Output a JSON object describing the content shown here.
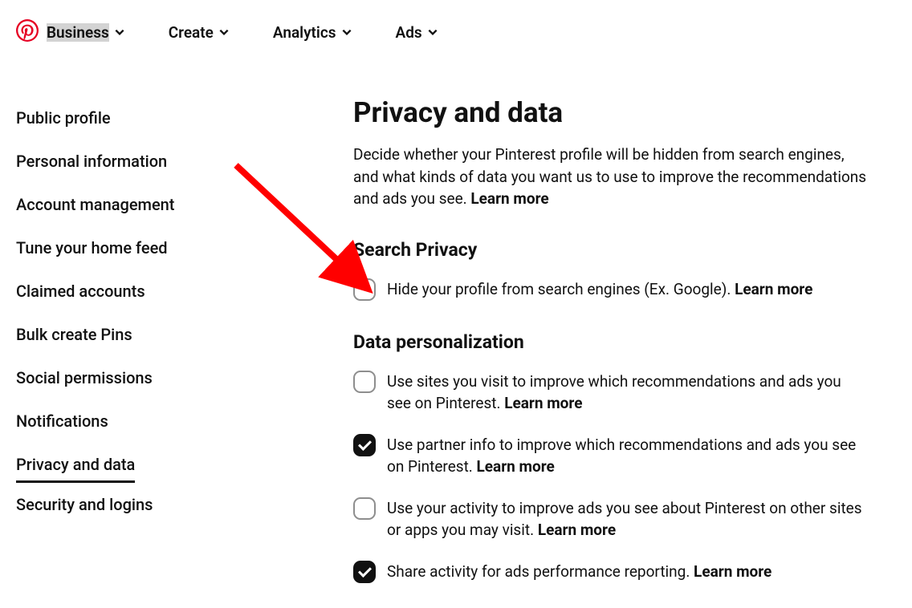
{
  "topnav": {
    "items": [
      {
        "label": "Business",
        "highlighted": true
      },
      {
        "label": "Create",
        "highlighted": false
      },
      {
        "label": "Analytics",
        "highlighted": false
      },
      {
        "label": "Ads",
        "highlighted": false
      }
    ]
  },
  "sidebar": {
    "items": [
      {
        "label": "Public profile",
        "active": false
      },
      {
        "label": "Personal information",
        "active": false
      },
      {
        "label": "Account management",
        "active": false
      },
      {
        "label": "Tune your home feed",
        "active": false
      },
      {
        "label": "Claimed accounts",
        "active": false
      },
      {
        "label": "Bulk create Pins",
        "active": false
      },
      {
        "label": "Social permissions",
        "active": false
      },
      {
        "label": "Notifications",
        "active": false
      },
      {
        "label": "Privacy and data",
        "active": true
      },
      {
        "label": "Security and logins",
        "active": false
      }
    ]
  },
  "content": {
    "title": "Privacy and data",
    "description": "Decide whether your Pinterest profile will be hidden from search engines, and what kinds of data you want us to use to improve the recommendations and ads you see. ",
    "learnMore": "Learn more",
    "sections": [
      {
        "title": "Search Privacy",
        "options": [
          {
            "text": "Hide your profile from search engines (Ex. Google). ",
            "learnMore": "Learn more",
            "checked": false
          }
        ]
      },
      {
        "title": "Data personalization",
        "options": [
          {
            "text": "Use sites you visit to improve which recommendations and ads you see on Pinterest. ",
            "learnMore": "Learn more",
            "checked": false
          },
          {
            "text": "Use partner info to improve which recommendations and ads you see on Pinterest. ",
            "learnMore": "Learn more",
            "checked": true
          },
          {
            "text": "Use your activity to improve ads you see about Pinterest on other sites or apps you may visit. ",
            "learnMore": "Learn more",
            "checked": false
          },
          {
            "text": "Share activity for ads performance reporting. ",
            "learnMore": "Learn more",
            "checked": true
          }
        ]
      }
    ]
  },
  "colors": {
    "brand": "#e60023",
    "arrow": "#ff0000"
  }
}
